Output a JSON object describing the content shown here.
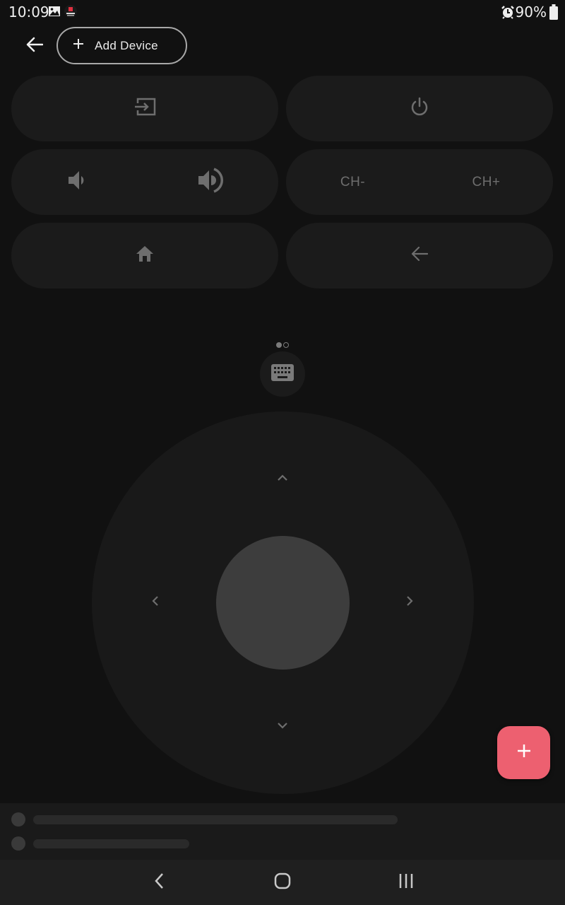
{
  "status_bar": {
    "time": "10:09",
    "notification_icons": [
      "image-icon",
      "app-notification-icon"
    ],
    "alarm_icon": "alarm-clock-icon",
    "battery_percent": "90%",
    "battery_icon": "battery-icon"
  },
  "top_bar": {
    "back_icon": "arrow-left-icon",
    "add_device_label": "Add Device",
    "add_device_icon": "plus-icon"
  },
  "remote": {
    "rows": [
      {
        "left": {
          "icon": "input-source-icon",
          "name": "input"
        },
        "right": {
          "icon": "power-icon",
          "name": "power"
        }
      },
      {
        "left": {
          "buttons": [
            {
              "icon": "volume-down-icon",
              "name": "volume-down"
            },
            {
              "icon": "volume-up-icon",
              "name": "volume-up"
            }
          ]
        },
        "right": {
          "buttons": [
            {
              "label": "CH-",
              "name": "channel-down"
            },
            {
              "label": "CH+",
              "name": "channel-up"
            }
          ]
        }
      },
      {
        "left": {
          "icon": "home-icon",
          "name": "home"
        },
        "right": {
          "icon": "arrow-left-icon",
          "name": "back"
        }
      }
    ],
    "ch_down_label": "CH-",
    "ch_up_label": "CH+"
  },
  "pager": {
    "pages": 2,
    "current": 1
  },
  "keyboard_icon": "keyboard-icon",
  "dpad": {
    "up_icon": "chevron-up-icon",
    "down_icon": "chevron-down-icon",
    "left_icon": "chevron-left-icon",
    "right_icon": "chevron-right-icon",
    "ok": "ok-button"
  },
  "fab": {
    "icon": "plus-icon"
  },
  "bottom_panel": {
    "rows": 2,
    "state": "loading-placeholder"
  },
  "nav_bar": {
    "back": "back-icon",
    "home": "home-icon",
    "recents": "recents-icon"
  },
  "colors": {
    "background": "#111111",
    "button": "#1b1b1b",
    "dpad_ring": "#191919",
    "dpad_center": "#3d3d3d",
    "icon": "#6e6e6e",
    "accent": "#ed6070"
  }
}
